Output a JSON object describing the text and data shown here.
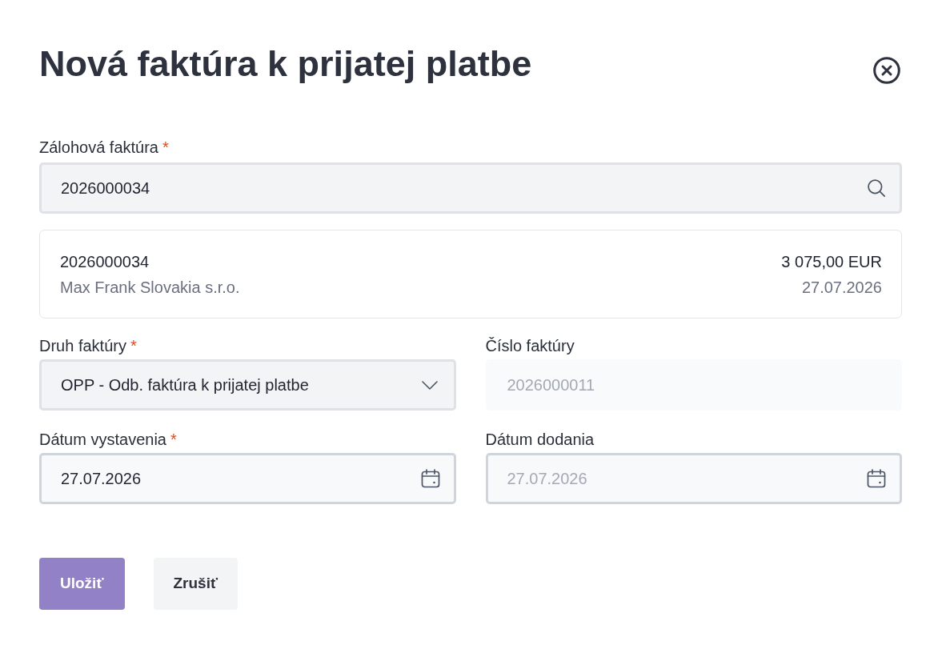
{
  "title": "Nová faktúra k prijatej platbe",
  "advance_invoice": {
    "label": "Zálohová faktúra",
    "required_mark": "*",
    "value": "2026000034"
  },
  "selected_invoice": {
    "number": "2026000034",
    "amount": "3 075,00 EUR",
    "company": "Max Frank Slovakia s.r.o.",
    "date": "27.07.2026"
  },
  "form_fields": [
    {
      "kind": "select",
      "label": "Druh faktúry",
      "required_mark": "*",
      "disabled": false,
      "value": "OPP - Odb. faktúra k prijatej platbe"
    },
    {
      "kind": "text",
      "label": "Číslo faktúry",
      "disabled": true,
      "value": "2026000011"
    },
    {
      "kind": "date",
      "label": "Dátum vystavenia",
      "required_mark": "*",
      "disabled": false,
      "value": "27.07.2026"
    },
    {
      "kind": "date",
      "label": "Dátum dodania",
      "disabled": false,
      "placeholder": "27.07.2026"
    }
  ],
  "buttons": [
    {
      "kind": "primary",
      "label": "Uložiť"
    },
    {
      "kind": "secondary",
      "label": "Zrušiť"
    }
  ]
}
